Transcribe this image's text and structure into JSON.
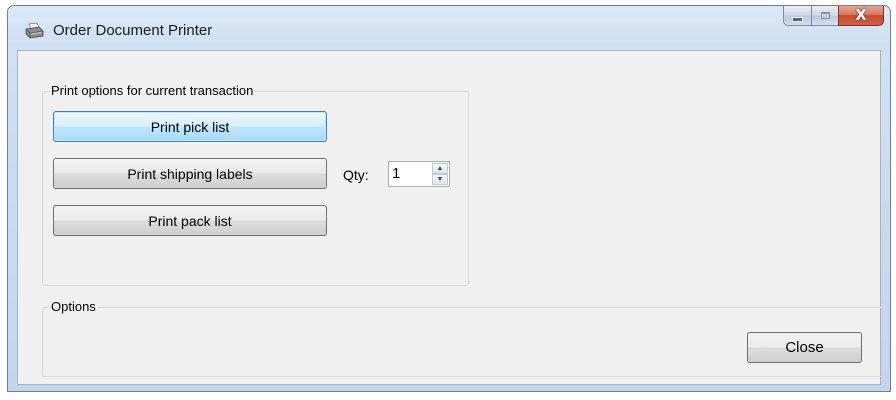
{
  "window": {
    "title": "Order Document Printer",
    "icon": "printer-icon",
    "caption_buttons": [
      "minimize-icon",
      "maximize-icon",
      "close-icon"
    ],
    "close_glyph": "X"
  },
  "print_group": {
    "legend": "Print options for current transaction",
    "pick_list_label": "Print pick list",
    "shipping_labels_label": "Print shipping labels",
    "pack_list_label": "Print pack list",
    "qty_label": "Qty:",
    "qty_value": "1"
  },
  "options_group": {
    "legend": "Options",
    "close_label": "Close"
  },
  "colors": {
    "focus_border": "#3c7fb1",
    "close_button": "#c44b30",
    "dialog_background": "#f0f0f0"
  }
}
